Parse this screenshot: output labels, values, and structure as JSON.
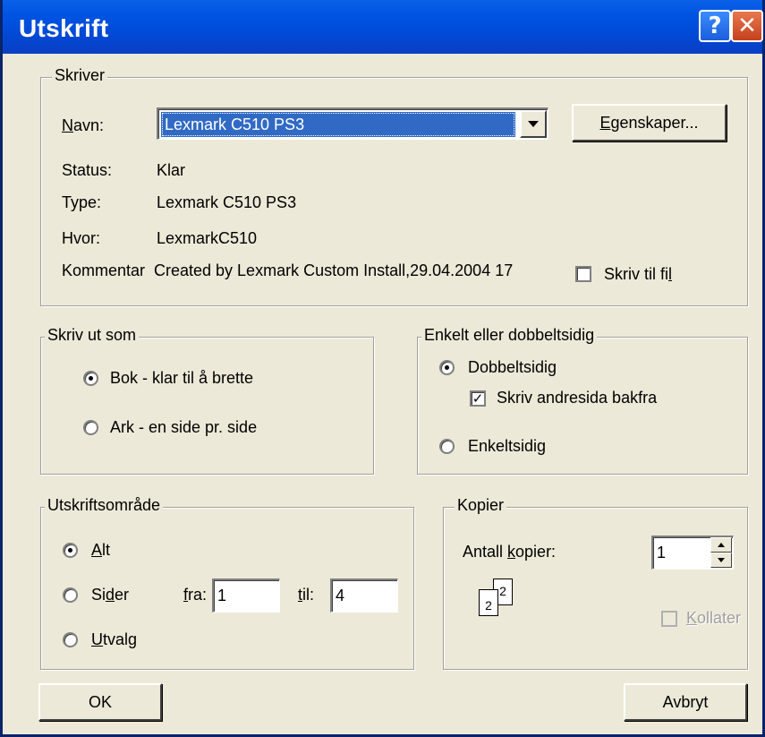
{
  "window": {
    "title": "Utskrift",
    "help_glyph": "?",
    "close_glyph": "✕"
  },
  "printer": {
    "legend": "Skriver",
    "name_label_accel": "N",
    "name_label_rest": "avn:",
    "selected_printer": "Lexmark C510 PS3",
    "properties_accel": "E",
    "properties_rest": "genskaper...",
    "status_label": "Status:",
    "status_value": "Klar",
    "type_label": "Type:",
    "type_value": "Lexmark C510 PS3",
    "where_label": "Hvor:",
    "where_value": "LexmarkC510",
    "comment_label": "Kommentar",
    "comment_value": "Created by Lexmark Custom Install,29.04.2004 17",
    "print_to_file_before": "Skriv til fi",
    "print_to_file_accel": "l",
    "print_to_file_checked": false
  },
  "print_as": {
    "legend": "Skriv ut som",
    "option_book": "Bok - klar til å brette",
    "option_sheet": "Ark - en side pr. side",
    "selected": "book"
  },
  "duplex": {
    "legend": "Enkelt eller dobbeltsidig",
    "option_double": "Dobbeltsidig",
    "backside_label": "Skriv andresida bakfra",
    "backside_checked": true,
    "option_single": "Enkeltsidig",
    "selected": "double"
  },
  "print_range": {
    "legend": "Utskriftsområde",
    "all_accel": "A",
    "all_rest": "lt",
    "pages_before": "Si",
    "pages_accel": "d",
    "pages_after": "er",
    "from_accel": "f",
    "from_rest": "ra:",
    "from_value": "1",
    "to_accel": "t",
    "to_rest": "il:",
    "to_value": "4",
    "selection_accel": "U",
    "selection_rest": "tvalg",
    "selected": "all"
  },
  "copies": {
    "legend": "Kopier",
    "count_before": "Antall ",
    "count_accel": "k",
    "count_after": "opier:",
    "count_value": "1",
    "icon_page_back": "2",
    "icon_page_front": "2",
    "collate_accel": "K",
    "collate_rest": "ollater",
    "collate_checked": false,
    "collate_enabled": false
  },
  "buttons": {
    "ok": "OK",
    "cancel": "Avbryt"
  }
}
